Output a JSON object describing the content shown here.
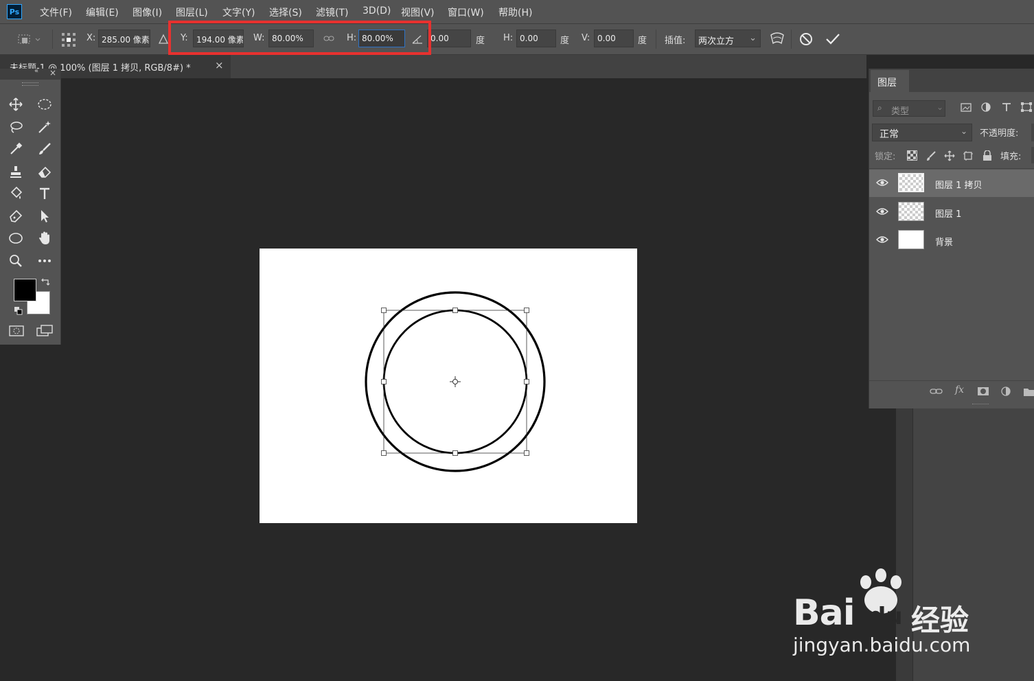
{
  "app": {
    "logo_text": "Ps"
  },
  "menu": [
    "文件(F)",
    "编辑(E)",
    "图像(I)",
    "图层(L)",
    "文字(Y)",
    "选择(S)",
    "滤镜(T)",
    "3D(D)",
    "视图(V)",
    "窗口(W)",
    "帮助(H)"
  ],
  "options": {
    "x_label": "X:",
    "x_value": "285.00 像素",
    "y_label": "Y:",
    "y_value": "194.00 像素",
    "w_label": "W:",
    "w_value": "80.00%",
    "h_label": "H:",
    "h_value": "80.00%",
    "angle_value": "0.00",
    "angle_unit": "度",
    "hskew_label": "H:",
    "hskew_value": "0.00",
    "hskew_unit": "度",
    "vskew_label": "V:",
    "vskew_value": "0.00",
    "vskew_unit": "度",
    "interp_label": "插值:",
    "interp_value": "两次立方"
  },
  "document_tab": {
    "title": "未标题-1 @ 100% (图层 1 拷贝, RGB/8#) *",
    "close": "×"
  },
  "layers_panel": {
    "tab_label": "图层",
    "filter_placeholder": "类型",
    "blend_mode": "正常",
    "opacity_label": "不透明度:",
    "lock_label": "锁定:",
    "fill_label": "填充:",
    "layers": [
      {
        "name": "图层 1 拷贝",
        "selected": true,
        "thumb": "transparent"
      },
      {
        "name": "图层 1",
        "selected": false,
        "thumb": "transparent"
      },
      {
        "name": "背景",
        "selected": false,
        "thumb": "white"
      }
    ]
  },
  "colors": {
    "highlight": "#e8312f",
    "foreground": "#000000",
    "background": "#ffffff"
  },
  "watermark": {
    "brand_left": "Bai",
    "brand_right": "du",
    "brand_cn": "经验",
    "url": "jingyan.baidu.com"
  }
}
